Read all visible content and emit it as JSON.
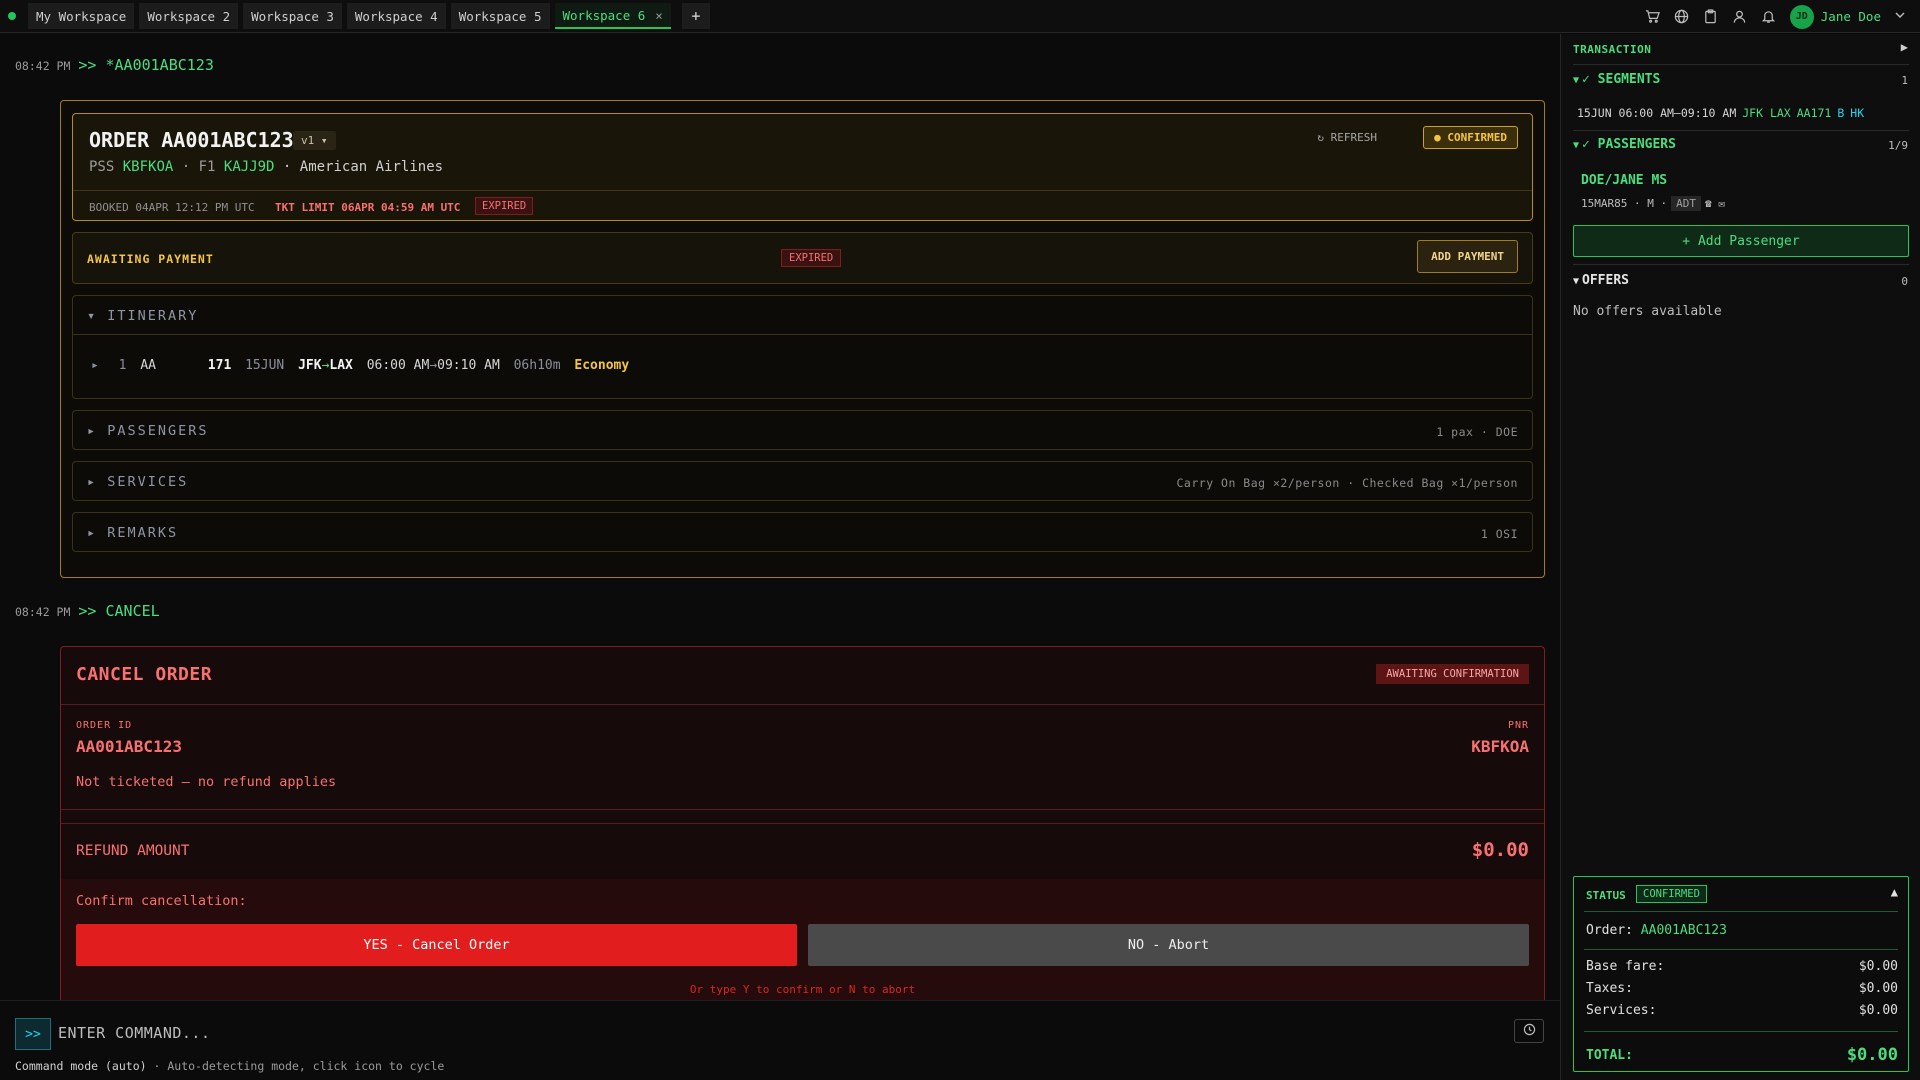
{
  "topbar": {
    "tabs": [
      "My Workspace",
      "Workspace 2",
      "Workspace 3",
      "Workspace 4",
      "Workspace 5",
      "Workspace 6"
    ],
    "active_tab": "Workspace 6",
    "close_glyph": "×",
    "add_tab": "+",
    "user": {
      "initials": "JD",
      "name": "Jane Doe"
    },
    "icons": [
      "cart-icon",
      "globe-icon",
      "clipboard-icon",
      "user-icon",
      "bell-icon"
    ]
  },
  "log": [
    {
      "time": "08:42 PM",
      "command": ">> *AA001ABC123"
    },
    {
      "time": "08:42 PM",
      "command": ">> CANCEL"
    }
  ],
  "order": {
    "title": "ORDER AA001ABC123",
    "version": "v1 ▾",
    "pss_label": "PSS",
    "pss_code": "KBFKOA",
    "f1_label": "· F1",
    "f1_code": "KAJJ9D",
    "airline": "· American Airlines",
    "refresh": "↻ REFRESH",
    "status": "● CONFIRMED",
    "booked": "BOOKED 04APR 12:12 PM UTC",
    "ticket_limit": "TKT LIMIT 06APR 04:59 AM UTC",
    "ticket_limit_badge": "EXPIRED"
  },
  "payment": {
    "label": "AWAITING PAYMENT",
    "badge": "EXPIRED",
    "button": "ADD PAYMENT"
  },
  "itinerary": {
    "header": "▾ ITINERARY",
    "segment": {
      "expand": "▸",
      "num": "1",
      "carrier": "AA",
      "flight": "171",
      "date": "15JUN",
      "origin": "JFK",
      "arrow": "→",
      "destination": "LAX",
      "depart": "06:00 AM",
      "arrive_arrow": "→",
      "arrive": "09:10 AM",
      "duration": "06h10m",
      "cabin": "Economy"
    }
  },
  "sections": {
    "passengers": {
      "header": "▸ PASSENGERS",
      "summary": "1 pax · DOE"
    },
    "services": {
      "header": "▸ SERVICES",
      "summary": "Carry On Bag ×2/person · Checked Bag ×1/person"
    },
    "remarks": {
      "header": "▸ REMARKS",
      "summary": "1 OSI"
    }
  },
  "cancel": {
    "title": "CANCEL ORDER",
    "status": "AWAITING CONFIRMATION",
    "order_id_label": "ORDER ID",
    "order_id": "AA001ABC123",
    "pnr_label": "PNR",
    "pnr": "KBFKOA",
    "note": "Not ticketed — no refund applies",
    "refund_label": "REFUND AMOUNT",
    "refund_amount": "$0.00",
    "confirm_label": "Confirm cancellation:",
    "yes_button": "YES - Cancel Order",
    "no_button": "NO - Abort",
    "hint": "Or type Y to confirm or N to abort"
  },
  "command": {
    "icon": ">>",
    "placeholder": "ENTER COMMAND...",
    "mode": "Command mode (auto)",
    "mode_hint": "· Auto-detecting mode, click icon to cycle"
  },
  "side": {
    "title": "TRANSACTION",
    "collapse": "▶",
    "segments": {
      "header": "✓ SEGMENTS",
      "caret": "▼",
      "count": "1",
      "row": {
        "when": "15JUN 06:00 AM–09:10 AM",
        "route": "JFK LAX",
        "flight": "AA171",
        "cls": "B",
        "status": "HK"
      }
    },
    "passengers": {
      "header": "✓ PASSENGERS",
      "caret": "▼",
      "count": "1/9",
      "name": "DOE/JANE MS",
      "dob": "15MAR85 · M ·",
      "type": "ADT",
      "extras": "☎ ✉",
      "add_button": "+ Add Passenger"
    },
    "offers": {
      "header": "OFFERS",
      "caret": "▼",
      "count": "0",
      "empty": "No offers available"
    },
    "status": {
      "label": "STATUS",
      "pill": "CONFIRMED",
      "toggle": "▲",
      "order_label": "Order:",
      "order_id": "AA001ABC123",
      "rows": [
        {
          "label": "Base fare:",
          "value": "$0.00"
        },
        {
          "label": "Taxes:",
          "value": "$0.00"
        },
        {
          "label": "Services:",
          "value": "$0.00"
        }
      ],
      "total_label": "TOTAL:",
      "total_value": "$0.00"
    }
  },
  "colors": {
    "accent": "#22c55e",
    "warning": "#f5c542",
    "danger": "#f87171",
    "cyan": "#22d3ee"
  }
}
